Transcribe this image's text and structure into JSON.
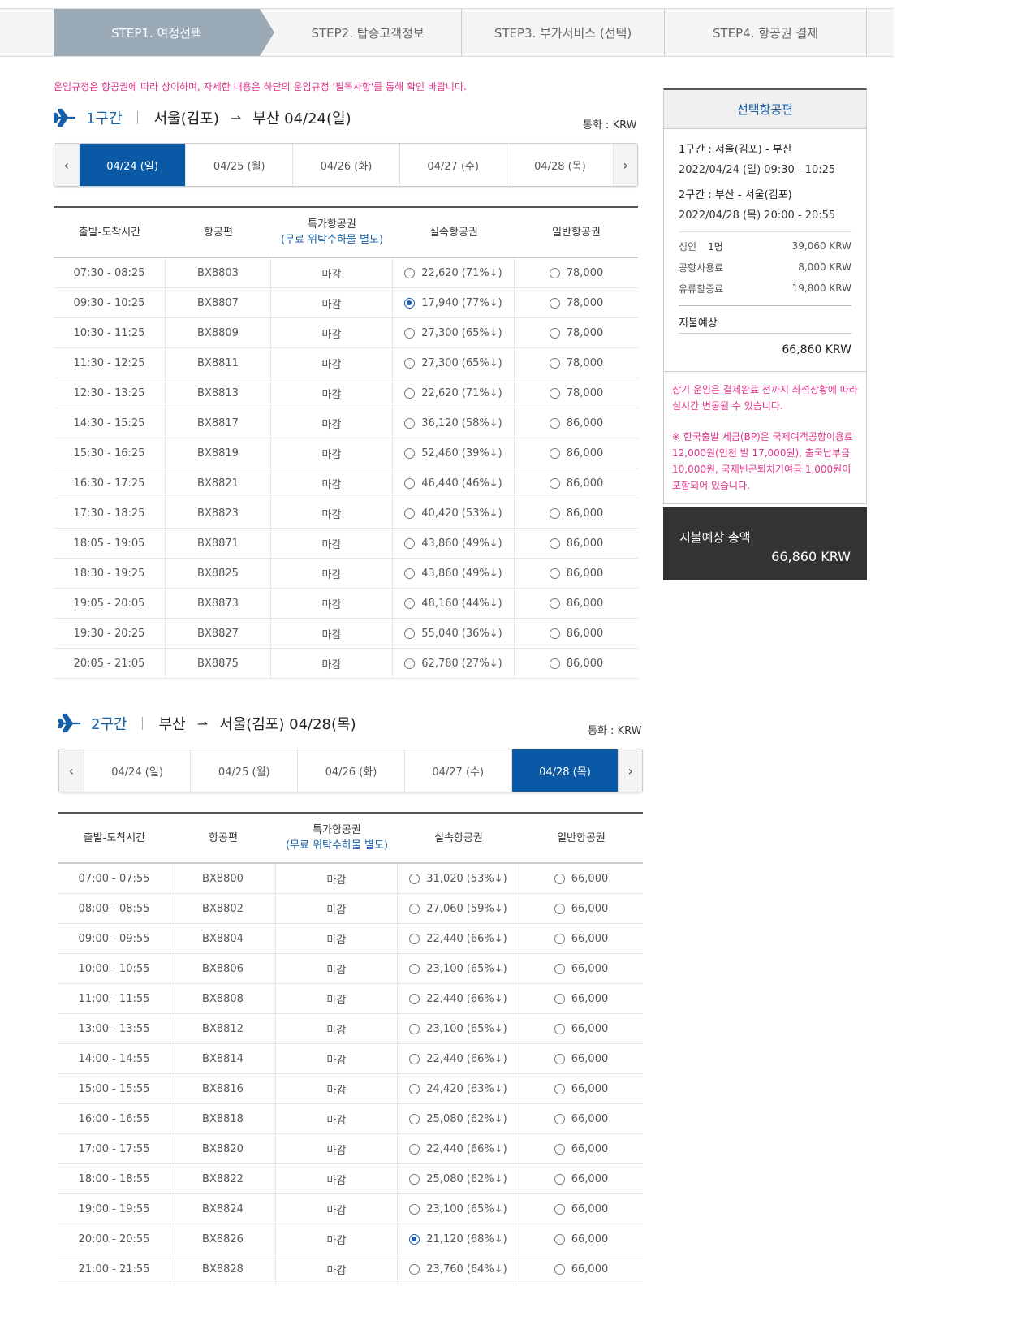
{
  "steps": [
    "STEP1. 여정선택",
    "STEP2. 탑승고객정보",
    "STEP3. 부가서비스 (선택)",
    "STEP4. 항공권 결제"
  ],
  "notice": "운임규정은 항공권에 따라 상이하며, 자세한 내용은 하단의 운임규정 '필독사항'를 통해 확인 바랍니다.",
  "table_headers": {
    "time": "출발-도착시간",
    "flight": "항공편",
    "special": "특가항공권",
    "special_sub": "(무료 위탁수하물 별도)",
    "saver": "실속항공권",
    "normal": "일반항공권"
  },
  "seg1": {
    "no": "1구간",
    "from": "서울(김포)",
    "to": "부산 04/24(일)",
    "currency": "통화 : KRW",
    "dates": [
      "04/24 (일)",
      "04/25 (월)",
      "04/26 (화)",
      "04/27 (수)",
      "04/28 (목)"
    ],
    "selected_date_index": 0,
    "rows": [
      {
        "time": "07:30 - 08:25",
        "flight": "BX8803",
        "special": "마감",
        "saver": "22,620",
        "pct": "(71%↓)",
        "normal": "78,000",
        "sel": false
      },
      {
        "time": "09:30 - 10:25",
        "flight": "BX8807",
        "special": "마감",
        "saver": "17,940",
        "pct": "(77%↓)",
        "normal": "78,000",
        "sel": true
      },
      {
        "time": "10:30 - 11:25",
        "flight": "BX8809",
        "special": "마감",
        "saver": "27,300",
        "pct": "(65%↓)",
        "normal": "78,000",
        "sel": false
      },
      {
        "time": "11:30 - 12:25",
        "flight": "BX8811",
        "special": "마감",
        "saver": "27,300",
        "pct": "(65%↓)",
        "normal": "78,000",
        "sel": false
      },
      {
        "time": "12:30 - 13:25",
        "flight": "BX8813",
        "special": "마감",
        "saver": "22,620",
        "pct": "(71%↓)",
        "normal": "78,000",
        "sel": false
      },
      {
        "time": "14:30 - 15:25",
        "flight": "BX8817",
        "special": "마감",
        "saver": "36,120",
        "pct": "(58%↓)",
        "normal": "86,000",
        "sel": false
      },
      {
        "time": "15:30 - 16:25",
        "flight": "BX8819",
        "special": "마감",
        "saver": "52,460",
        "pct": "(39%↓)",
        "normal": "86,000",
        "sel": false
      },
      {
        "time": "16:30 - 17:25",
        "flight": "BX8821",
        "special": "마감",
        "saver": "46,440",
        "pct": "(46%↓)",
        "normal": "86,000",
        "sel": false
      },
      {
        "time": "17:30 - 18:25",
        "flight": "BX8823",
        "special": "마감",
        "saver": "40,420",
        "pct": "(53%↓)",
        "normal": "86,000",
        "sel": false
      },
      {
        "time": "18:05 - 19:05",
        "flight": "BX8871",
        "special": "마감",
        "saver": "43,860",
        "pct": "(49%↓)",
        "normal": "86,000",
        "sel": false
      },
      {
        "time": "18:30 - 19:25",
        "flight": "BX8825",
        "special": "마감",
        "saver": "43,860",
        "pct": "(49%↓)",
        "normal": "86,000",
        "sel": false
      },
      {
        "time": "19:05 - 20:05",
        "flight": "BX8873",
        "special": "마감",
        "saver": "48,160",
        "pct": "(44%↓)",
        "normal": "86,000",
        "sel": false
      },
      {
        "time": "19:30 - 20:25",
        "flight": "BX8827",
        "special": "마감",
        "saver": "55,040",
        "pct": "(36%↓)",
        "normal": "86,000",
        "sel": false
      },
      {
        "time": "20:05 - 21:05",
        "flight": "BX8875",
        "special": "마감",
        "saver": "62,780",
        "pct": "(27%↓)",
        "normal": "86,000",
        "sel": false
      }
    ]
  },
  "seg2": {
    "no": "2구간",
    "from": "부산",
    "to": "서울(김포) 04/28(목)",
    "currency": "통화 : KRW",
    "dates": [
      "04/24 (일)",
      "04/25 (월)",
      "04/26 (화)",
      "04/27 (수)",
      "04/28 (목)"
    ],
    "selected_date_index": 4,
    "rows": [
      {
        "time": "07:00 - 07:55",
        "flight": "BX8800",
        "special": "마감",
        "saver": "31,020",
        "pct": "(53%↓)",
        "normal": "66,000",
        "sel": false
      },
      {
        "time": "08:00 - 08:55",
        "flight": "BX8802",
        "special": "마감",
        "saver": "27,060",
        "pct": "(59%↓)",
        "normal": "66,000",
        "sel": false
      },
      {
        "time": "09:00 - 09:55",
        "flight": "BX8804",
        "special": "마감",
        "saver": "22,440",
        "pct": "(66%↓)",
        "normal": "66,000",
        "sel": false
      },
      {
        "time": "10:00 - 10:55",
        "flight": "BX8806",
        "special": "마감",
        "saver": "23,100",
        "pct": "(65%↓)",
        "normal": "66,000",
        "sel": false
      },
      {
        "time": "11:00 - 11:55",
        "flight": "BX8808",
        "special": "마감",
        "saver": "22,440",
        "pct": "(66%↓)",
        "normal": "66,000",
        "sel": false
      },
      {
        "time": "13:00 - 13:55",
        "flight": "BX8812",
        "special": "마감",
        "saver": "23,100",
        "pct": "(65%↓)",
        "normal": "66,000",
        "sel": false
      },
      {
        "time": "14:00 - 14:55",
        "flight": "BX8814",
        "special": "마감",
        "saver": "22,440",
        "pct": "(66%↓)",
        "normal": "66,000",
        "sel": false
      },
      {
        "time": "15:00 - 15:55",
        "flight": "BX8816",
        "special": "마감",
        "saver": "24,420",
        "pct": "(63%↓)",
        "normal": "66,000",
        "sel": false
      },
      {
        "time": "16:00 - 16:55",
        "flight": "BX8818",
        "special": "마감",
        "saver": "25,080",
        "pct": "(62%↓)",
        "normal": "66,000",
        "sel": false
      },
      {
        "time": "17:00 - 17:55",
        "flight": "BX8820",
        "special": "마감",
        "saver": "22,440",
        "pct": "(66%↓)",
        "normal": "66,000",
        "sel": false
      },
      {
        "time": "18:00 - 18:55",
        "flight": "BX8822",
        "special": "마감",
        "saver": "25,080",
        "pct": "(62%↓)",
        "normal": "66,000",
        "sel": false
      },
      {
        "time": "19:00 - 19:55",
        "flight": "BX8824",
        "special": "마감",
        "saver": "23,100",
        "pct": "(65%↓)",
        "normal": "66,000",
        "sel": false
      },
      {
        "time": "20:00 - 20:55",
        "flight": "BX8826",
        "special": "마감",
        "saver": "21,120",
        "pct": "(68%↓)",
        "normal": "66,000",
        "sel": true
      },
      {
        "time": "21:00 - 21:55",
        "flight": "BX8828",
        "special": "마감",
        "saver": "23,760",
        "pct": "(64%↓)",
        "normal": "66,000",
        "sel": false
      }
    ]
  },
  "side": {
    "title": "선택항공편",
    "seg1_label": "1구간 : 서울(김포) - 부산",
    "seg1_time": "2022/04/24 (일) 09:30 - 10:25",
    "seg2_label": "2구간 : 부산 - 서울(김포)",
    "seg2_time": "2022/04/28 (목) 20:00 - 20:55",
    "fees": [
      {
        "label": "성인",
        "count": "1명",
        "value": "39,060 KRW"
      },
      {
        "label": "공항사용료",
        "count": "",
        "value": "8,000 KRW"
      },
      {
        "label": "유류할증료",
        "count": "",
        "value": "19,800 KRW"
      }
    ],
    "est_label": "지불예상",
    "est_value": "66,860 KRW",
    "note1": "상기 운임은 결제완료 전까지 좌석상황에 따라 실시간 변동될 수 있습니다.",
    "note2": "※ 한국출발 세금(BP)은 국제여객공항이용료 12,000원(인천 발 17,000원), 출국납부금 10,000원, 국제빈곤퇴치기여금 1,000원이 포함되어 있습니다."
  },
  "total": {
    "label": "지불예상 총액",
    "value": "66,860 KRW"
  },
  "nav": {
    "prev": "‹",
    "next": "›"
  },
  "colors": {
    "accent": "#0a59a6",
    "notice": "#e0358a",
    "step_active": "#9aaab7"
  }
}
